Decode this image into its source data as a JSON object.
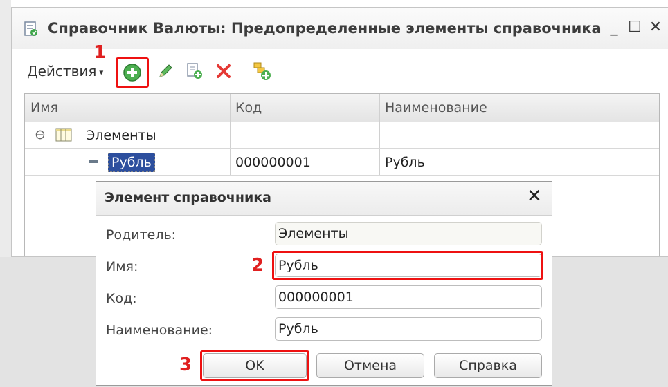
{
  "window": {
    "title": "Справочник Валюты: Предопределенные элементы справочника",
    "minimize_glyph": "_",
    "maximize_glyph": "☐",
    "close_glyph": "✕"
  },
  "toolbar": {
    "actions_label": "Действия",
    "icons": [
      "add-circle-icon",
      "edit-pencil-icon",
      "copy-icon",
      "delete-cross-icon",
      "add-folder-icon"
    ]
  },
  "annotations": {
    "step1": "1",
    "step2": "2",
    "step3": "3",
    "color": "#e02020"
  },
  "table": {
    "columns": [
      "Имя",
      "Код",
      "Наименование"
    ],
    "rows": [
      {
        "name": "Элементы",
        "code": "",
        "title": ""
      },
      {
        "name": "Рубль",
        "code": "000000001",
        "title": "Рубль"
      }
    ],
    "tree_toggle": "⊖"
  },
  "dialog": {
    "title": "Элемент справочника",
    "close_glyph": "✕",
    "fields": {
      "parent": {
        "label": "Родитель:",
        "value": "Элементы"
      },
      "name": {
        "label": "Имя:",
        "value": "Рубль"
      },
      "code": {
        "label": "Код:",
        "value": "000000001"
      },
      "title": {
        "label": "Наименование:",
        "value": "Рубль"
      }
    },
    "buttons": {
      "ok": "OK",
      "cancel": "Отмена",
      "help": "Справка"
    }
  },
  "colors": {
    "selection": "#2d4f9e",
    "highlight": "#ee1111"
  }
}
